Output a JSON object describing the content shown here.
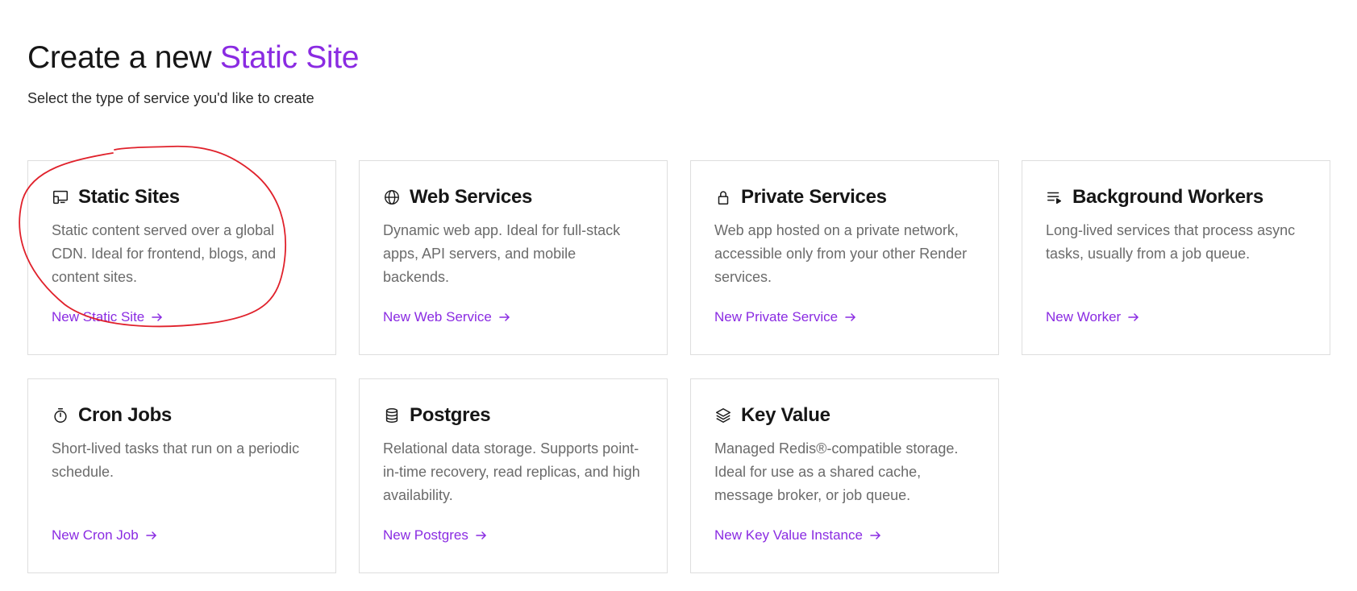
{
  "header": {
    "title_prefix": "Create a new",
    "title_accent": "Static Site",
    "subtitle": "Select the type of service you'd like to create"
  },
  "colors": {
    "accent": "#8a2be2",
    "annotation_stroke": "#e0212b",
    "card_border": "#dedede",
    "desc_text": "#6b6b6b"
  },
  "services": [
    {
      "icon": "static-site-icon",
      "title": "Static Sites",
      "description": "Static content served over a global CDN. Ideal for frontend, blogs, and content sites.",
      "link": "New Static Site"
    },
    {
      "icon": "globe-icon",
      "title": "Web Services",
      "description": "Dynamic web app. Ideal for full-stack apps, API servers, and mobile backends.",
      "link": "New Web Service"
    },
    {
      "icon": "lock-icon",
      "title": "Private Services",
      "description": "Web app hosted on a private network, accessible only from your other Render services.",
      "link": "New Private Service"
    },
    {
      "icon": "queue-list-icon",
      "title": "Background Workers",
      "description": "Long-lived services that process async tasks, usually from a job queue.",
      "link": "New Worker"
    },
    {
      "icon": "stopwatch-icon",
      "title": "Cron Jobs",
      "description": "Short-lived tasks that run on a periodic schedule.",
      "link": "New Cron Job"
    },
    {
      "icon": "database-icon",
      "title": "Postgres",
      "description": "Relational data storage. Supports point-in-time recovery, read replicas, and high availability.",
      "link": "New Postgres"
    },
    {
      "icon": "layers-icon",
      "title": "Key Value",
      "description": "Managed Redis®-compatible storage. Ideal for use as a shared cache, message broker, or job queue.",
      "link": "New Key Value Instance"
    }
  ]
}
